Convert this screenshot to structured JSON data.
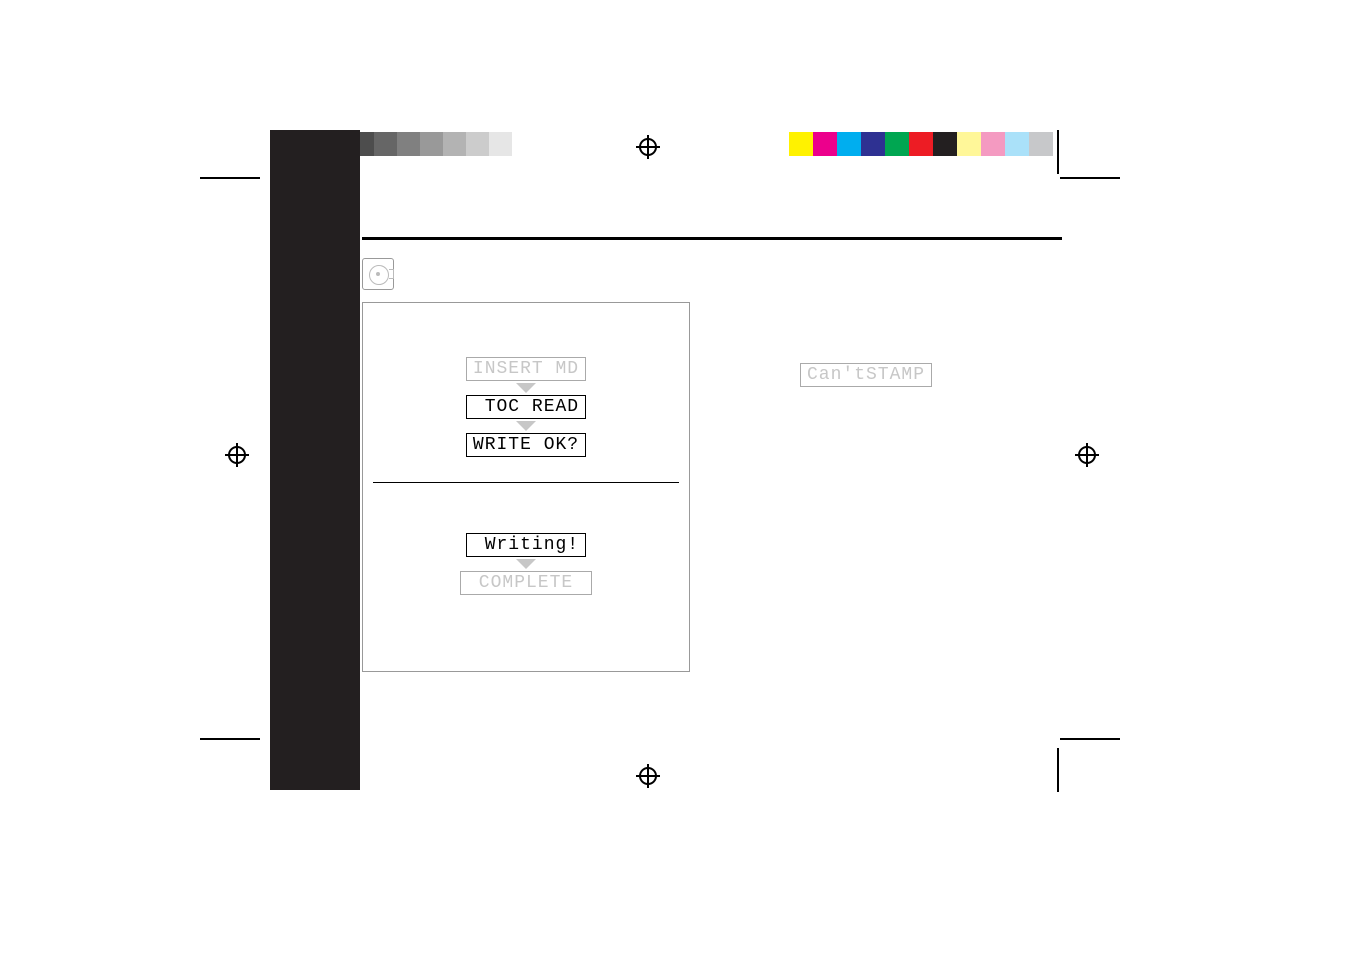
{
  "print_marks": {
    "gray_bar_levels": [
      "#000000",
      "#1a1a1a",
      "#333333",
      "#4d4d4d",
      "#666666",
      "#808080",
      "#999999",
      "#b3b3b3",
      "#cccccc",
      "#e6e6e6",
      "#ffffff"
    ],
    "color_bar": [
      "#fff200",
      "#ec008c",
      "#00aeef",
      "#2e3192",
      "#00a651",
      "#ed1c24",
      "#231f20",
      "#fff799",
      "#f49ac1",
      "#aae1f9",
      "#c7c8ca"
    ]
  },
  "flow": {
    "top": {
      "s1": "INSERT MD",
      "s2": " TOC READ",
      "s3": "WRITE OK?"
    },
    "bottom": {
      "s1": " Writing!",
      "s2": " COMPLETE "
    }
  },
  "right_message": "Can'tSTAMP"
}
